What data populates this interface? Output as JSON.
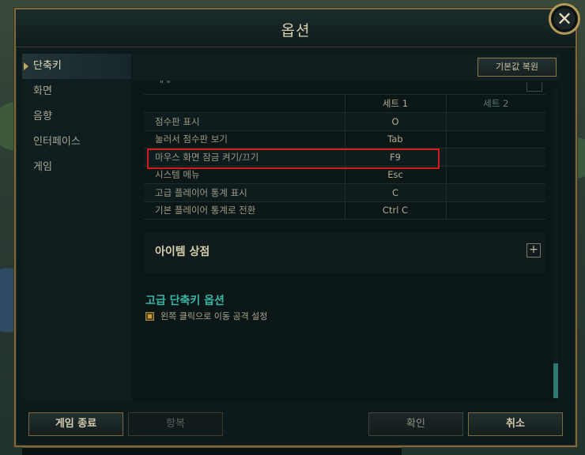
{
  "dialog": {
    "title": "옵션",
    "close_label": "✕"
  },
  "sidebar": {
    "items": [
      {
        "label": "단축키",
        "active": true
      },
      {
        "label": "화면",
        "active": false
      },
      {
        "label": "음향",
        "active": false
      },
      {
        "label": "인터페이스",
        "active": false
      },
      {
        "label": "게임",
        "active": false
      }
    ]
  },
  "toolbar": {
    "restore_defaults": "기본값 복원"
  },
  "hotkeys": {
    "partial_row": "\" \"",
    "columns": {
      "set1": "세트 1",
      "set2": "세트 2"
    },
    "rows": [
      {
        "action": "점수판 표시",
        "set1": "O",
        "set2": ""
      },
      {
        "action": "눌러서 점수판 보기",
        "set1": "Tab",
        "set2": ""
      },
      {
        "action": "마우스 화면 잠금 켜기/끄기",
        "set1": "F9",
        "set2": ""
      },
      {
        "action": "시스템 메뉴",
        "set1": "Esc",
        "set2": ""
      },
      {
        "action": "고급 플레이어 통계 표시",
        "set1": "C",
        "set2": ""
      },
      {
        "action": "기본 플레이어 통계로 전환",
        "set1": "Ctrl  C",
        "set2": ""
      }
    ],
    "highlight_color": "#d21b1b"
  },
  "item_shop": {
    "title": "아이템 상점",
    "expand_label": "+"
  },
  "advanced": {
    "title": "고급 단축키 옵션",
    "option_label": "왼쪽 클릭으로 이동 공격 설정",
    "option_checked": true
  },
  "buttons": {
    "quit": "게임 종료",
    "surrender": "항복",
    "ok": "확인",
    "cancel": "취소"
  },
  "colors": {
    "accent_gold": "#b39a5a",
    "accent_teal": "#37b6a4"
  }
}
